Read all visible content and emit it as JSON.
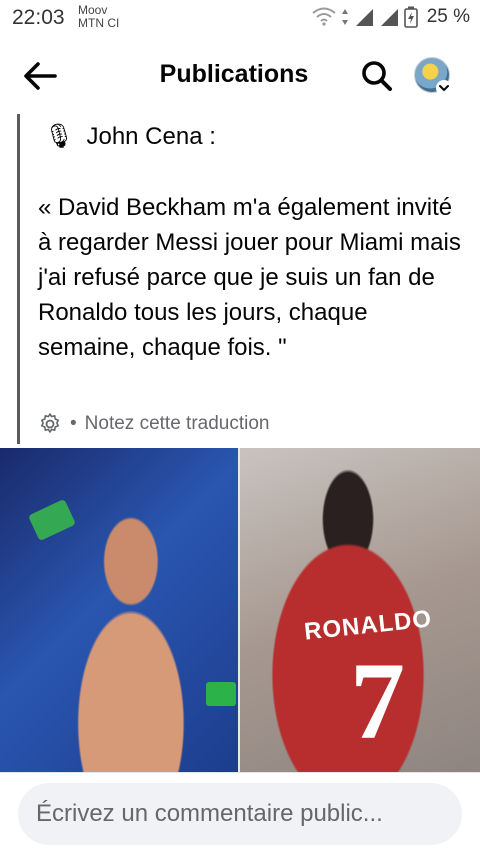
{
  "status_bar": {
    "time": "22:03",
    "carrier_line1": "Moov",
    "carrier_line2": "MTN CI",
    "battery_percent": "25 %",
    "icons": [
      "wifi-icon",
      "signal-icon",
      "signal-icon",
      "battery-charging-icon"
    ]
  },
  "header": {
    "title": "Publications",
    "back_icon": "arrow-left-icon",
    "search_icon": "search-icon",
    "avatar_menu_icon": "chevron-down-icon"
  },
  "post": {
    "author_emoji": "🎙",
    "author_line": "John Cena :",
    "body": "« David Beckham m'a également invité à regarder Messi jouer pour Miami mais j'ai refusé parce que je suis un fan de Ronaldo tous les jours, chaque semaine, chaque fois. \"",
    "translation_separator": "•",
    "translation_label": "Notez cette traduction",
    "translation_icon": "gear-icon"
  },
  "images": {
    "right_jersey_name": "RONALDO",
    "right_jersey_number": "7"
  },
  "comment": {
    "placeholder": "Écrivez un commentaire public..."
  },
  "colors": {
    "text_primary": "#050505",
    "text_secondary": "#65676b",
    "input_bg": "#f0f2f5",
    "quote_bar": "#5b5b5b"
  }
}
